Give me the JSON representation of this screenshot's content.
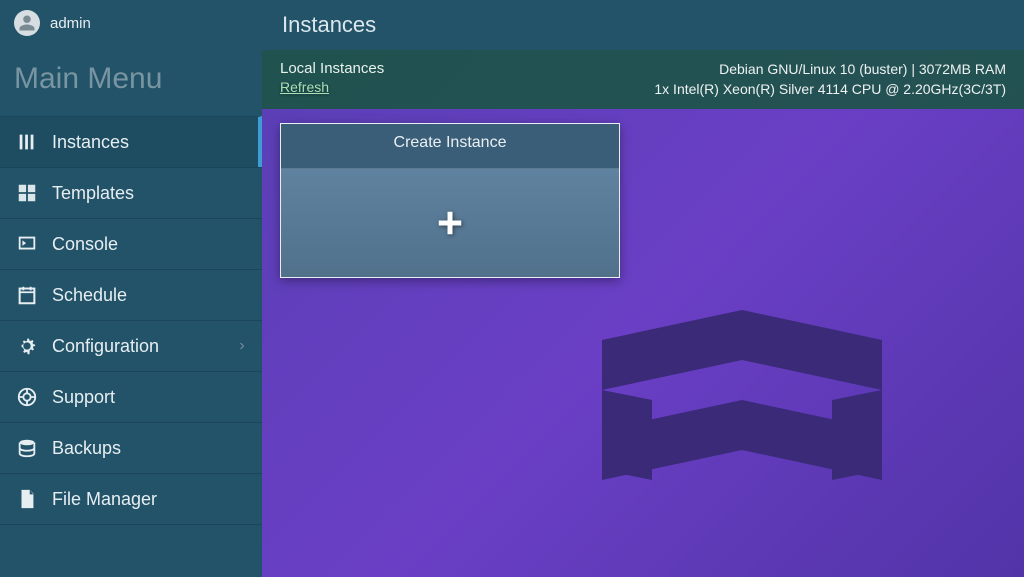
{
  "user": {
    "name": "admin"
  },
  "menu": {
    "header": "Main Menu",
    "items": [
      {
        "label": "Instances"
      },
      {
        "label": "Templates"
      },
      {
        "label": "Console"
      },
      {
        "label": "Schedule"
      },
      {
        "label": "Configuration"
      },
      {
        "label": "Support"
      },
      {
        "label": "Backups"
      },
      {
        "label": "File Manager"
      }
    ]
  },
  "page": {
    "title": "Instances"
  },
  "infoBar": {
    "title": "Local Instances",
    "refresh": "Refresh",
    "system_line1": "Debian GNU/Linux 10 (buster) | 3072MB RAM",
    "system_line2": "1x Intel(R) Xeon(R) Silver 4114 CPU @ 2.20GHz(3C/3T)"
  },
  "card": {
    "title": "Create Instance"
  }
}
